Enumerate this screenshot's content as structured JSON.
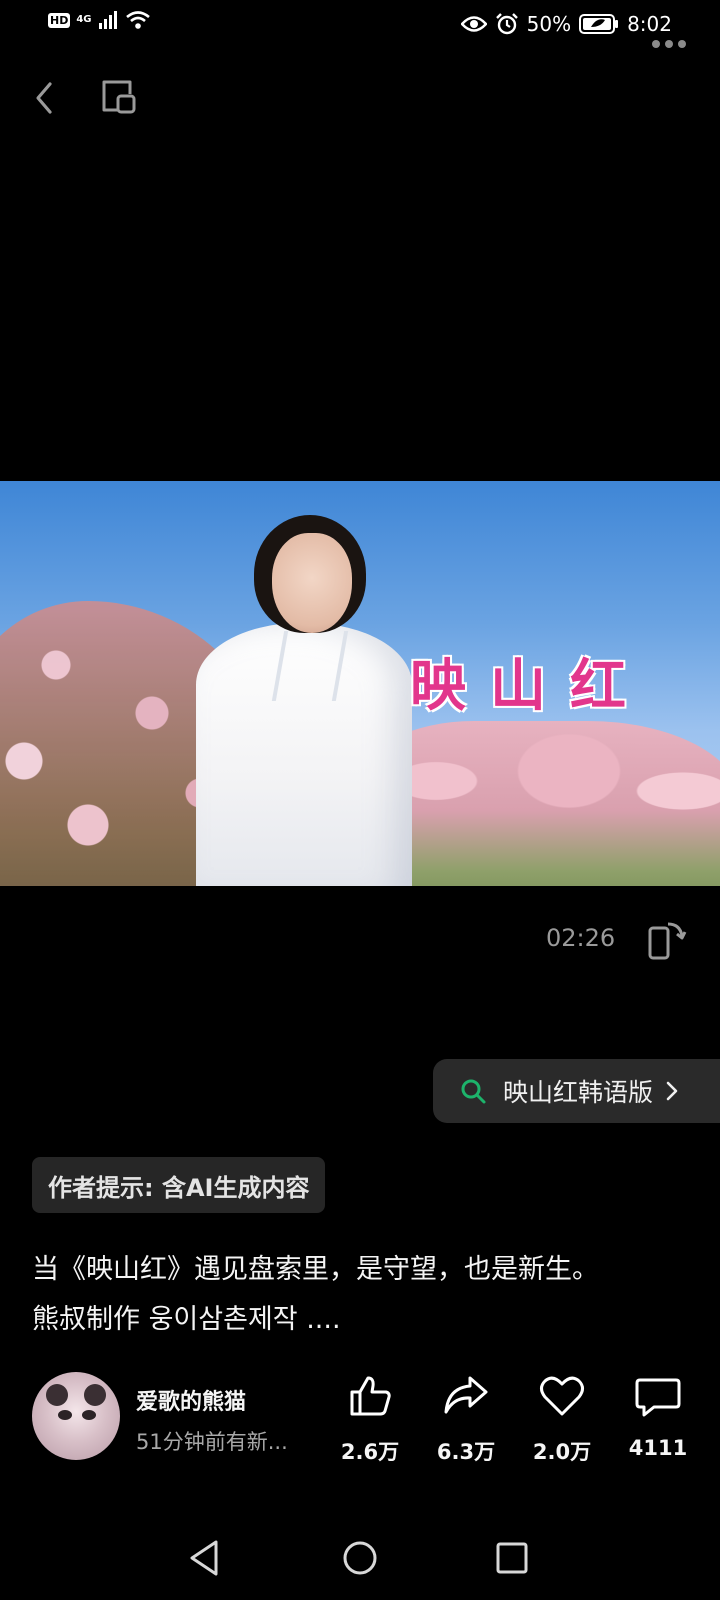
{
  "status_bar": {
    "hd": "HD",
    "network": "4G",
    "battery": "50%",
    "time": "8:02"
  },
  "video": {
    "title_overlay": "映山红",
    "duration": "02:26"
  },
  "search": {
    "query": "映山红韩语版"
  },
  "author_tip": "作者提示: 含AI生成内容",
  "description": {
    "line1": "当《映山红》遇见盘索里，是守望，也是新生。",
    "line2": "熊叔制作 웅이삼촌제작 ...."
  },
  "creator": {
    "name": "爱歌的熊猫",
    "subtitle": "51分钟前有新..."
  },
  "actions": {
    "like_count": "2.6万",
    "share_count": "6.3万",
    "favorite_count": "2.0万",
    "comment_count": "4111"
  },
  "colors": {
    "background": "#000000",
    "search_icon": "#1db36b",
    "title_pink": "#e2368c"
  }
}
